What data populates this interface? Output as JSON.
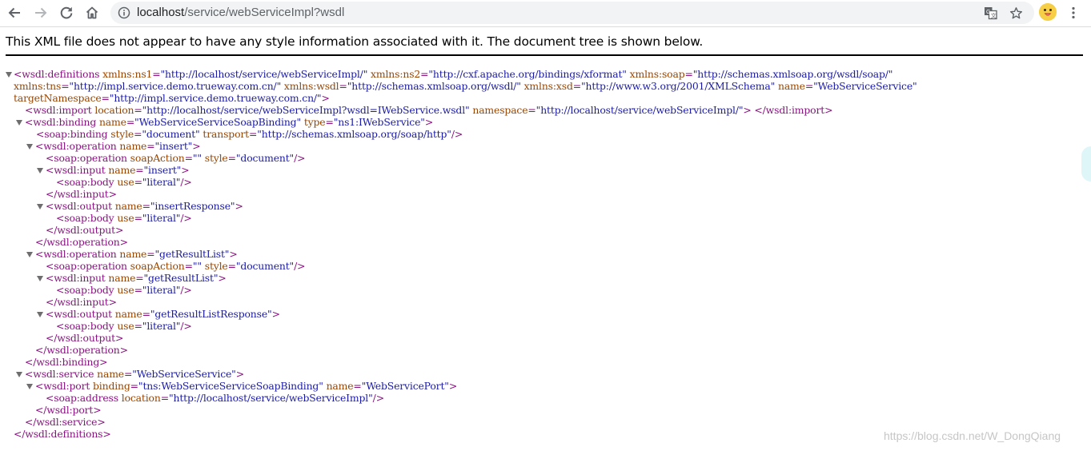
{
  "toolbar": {
    "url_host": "localhost",
    "url_path": "/service/webServiceImpl?wsdl",
    "icons": [
      "back-icon",
      "forward-icon",
      "reload-icon",
      "home-icon",
      "info-icon",
      "translate-icon",
      "star-icon",
      "avatar",
      "more-icon"
    ]
  },
  "page": {
    "header": "This XML file does not appear to have any style information associated with it. The document tree is shown below.",
    "watermark": "https://blog.csdn.net/W_DongQiang"
  },
  "tree": {
    "l1": {
      "open": "<wsdl:definitions",
      "a1n": "xmlns:ns1",
      "a1v": "\"http://localhost/service/webServiceImpl/\"",
      "a2n": "xmlns:ns2",
      "a2v": "\"http://cxf.apache.org/bindings/xformat\"",
      "a3n": "xmlns:soap",
      "a3v": "\"http://schemas.xmlsoap.org/wsdl/soap/\""
    },
    "l2": {
      "a1n": "xmlns:tns",
      "a1v": "\"http://impl.service.demo.trueway.com.cn/\"",
      "a2n": "xmlns:wsdl",
      "a2v": "\"http://schemas.xmlsoap.org/wsdl/\"",
      "a3n": "xmlns:xsd",
      "a3v": "\"http://www.w3.org/2001/XMLSchema\"",
      "a4n": "name",
      "a4v": "\"WebServiceService\""
    },
    "l3": {
      "a1n": "targetNamespace",
      "a1v": "\"http://impl.service.demo.trueway.com.cn/\"",
      "close": ">"
    },
    "l4": {
      "open": "<wsdl:import",
      "a1n": "location",
      "a1v": "\"http://localhost/service/webServiceImpl?wsdl=IWebService.wsdl\"",
      "a2n": "namespace",
      "a2v": "\"http://localhost/service/webServiceImpl/\"",
      "close": "> </wsdl:import>"
    },
    "l5": {
      "open": "<wsdl:binding",
      "a1n": "name",
      "a1v": "\"WebServiceServiceSoapBinding\"",
      "a2n": "type",
      "a2v": "\"ns1:IWebService\"",
      "close": ">"
    },
    "l6": {
      "open": "<soap:binding",
      "a1n": "style",
      "a1v": "\"document\"",
      "a2n": "transport",
      "a2v": "\"http://schemas.xmlsoap.org/soap/http\"",
      "close": "/>"
    },
    "l7": {
      "open": "<wsdl:operation",
      "a1n": "name",
      "a1v": "\"insert\"",
      "close": ">"
    },
    "l8": {
      "open": "<soap:operation",
      "a1n": "soapAction",
      "a1v": "\"\"",
      "a2n": "style",
      "a2v": "\"document\"",
      "close": "/>"
    },
    "l9": {
      "open": "<wsdl:input",
      "a1n": "name",
      "a1v": "\"insert\"",
      "close": ">"
    },
    "l10": {
      "open": "<soap:body",
      "a1n": "use",
      "a1v": "\"literal\"",
      "close": "/>"
    },
    "l11": {
      "close": "</wsdl:input>"
    },
    "l12": {
      "open": "<wsdl:output",
      "a1n": "name",
      "a1v": "\"insertResponse\"",
      "close": ">"
    },
    "l13": {
      "open": "<soap:body",
      "a1n": "use",
      "a1v": "\"literal\"",
      "close": "/>"
    },
    "l14": {
      "close": "</wsdl:output>"
    },
    "l15": {
      "close": "</wsdl:operation>"
    },
    "l16": {
      "open": "<wsdl:operation",
      "a1n": "name",
      "a1v": "\"getResultList\"",
      "close": ">"
    },
    "l17": {
      "open": "<soap:operation",
      "a1n": "soapAction",
      "a1v": "\"\"",
      "a2n": "style",
      "a2v": "\"document\"",
      "close": "/>"
    },
    "l18": {
      "open": "<wsdl:input",
      "a1n": "name",
      "a1v": "\"getResultList\"",
      "close": ">"
    },
    "l19": {
      "open": "<soap:body",
      "a1n": "use",
      "a1v": "\"literal\"",
      "close": "/>"
    },
    "l20": {
      "close": "</wsdl:input>"
    },
    "l21": {
      "open": "<wsdl:output",
      "a1n": "name",
      "a1v": "\"getResultListResponse\"",
      "close": ">"
    },
    "l22": {
      "open": "<soap:body",
      "a1n": "use",
      "a1v": "\"literal\"",
      "close": "/>"
    },
    "l23": {
      "close": "</wsdl:output>"
    },
    "l24": {
      "close": "</wsdl:operation>"
    },
    "l25": {
      "close": "</wsdl:binding>"
    },
    "l26": {
      "open": "<wsdl:service",
      "a1n": "name",
      "a1v": "\"WebServiceService\"",
      "close": ">"
    },
    "l27": {
      "open": "<wsdl:port",
      "a1n": "binding",
      "a1v": "\"tns:WebServiceServiceSoapBinding\"",
      "a2n": "name",
      "a2v": "\"WebServicePort\"",
      "close": ">"
    },
    "l28": {
      "open": "<soap:address",
      "a1n": "location",
      "a1v": "\"http://localhost/service/webServiceImpl\"",
      "close": "/>"
    },
    "l29": {
      "close": "</wsdl:port>"
    },
    "l30": {
      "close": "</wsdl:service>"
    },
    "l31": {
      "close": "</wsdl:definitions>"
    }
  }
}
